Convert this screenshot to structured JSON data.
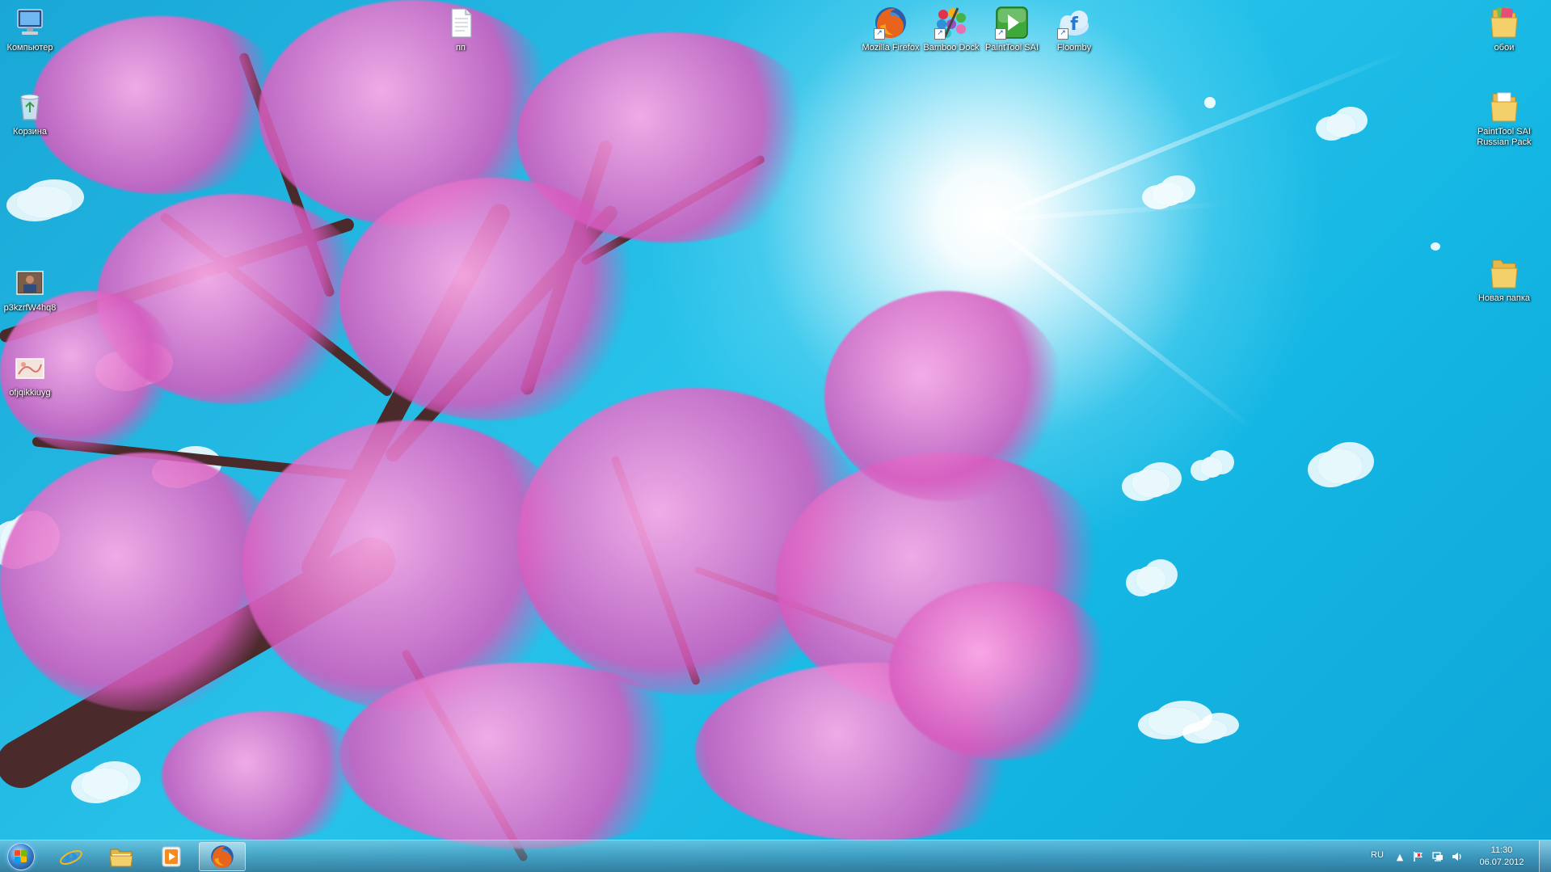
{
  "desktop": {
    "icons": [
      {
        "label": "Компьютер",
        "icon": "computer-icon"
      },
      {
        "label": "Корзина",
        "icon": "recycle-bin-icon"
      },
      {
        "label": "p3kzrfW4hq8",
        "icon": "image-file-icon"
      },
      {
        "label": "ofjqikkiuyg",
        "icon": "image-file-icon"
      },
      {
        "label": "пп",
        "icon": "text-file-icon"
      },
      {
        "label": "Mozilla Firefox",
        "icon": "firefox-icon"
      },
      {
        "label": "Bamboo Dock",
        "icon": "bamboo-dock-icon"
      },
      {
        "label": "PaintTool SAI",
        "icon": "painttool-sai-icon"
      },
      {
        "label": "Floomby",
        "icon": "floomby-icon"
      },
      {
        "label": "обои",
        "icon": "folder-icon"
      },
      {
        "label": "PaintTool SAI Russian Pack",
        "icon": "folder-icon"
      },
      {
        "label": "Новая папка",
        "icon": "folder-icon"
      }
    ]
  },
  "taskbar": {
    "pinned": [
      {
        "name": "internet-explorer",
        "icon": "internet-explorer-icon"
      },
      {
        "name": "explorer",
        "icon": "folder-icon"
      },
      {
        "name": "media-player",
        "icon": "media-player-icon"
      },
      {
        "name": "firefox",
        "icon": "firefox-icon",
        "active": true
      }
    ],
    "tray": {
      "language": "RU",
      "time": "11:30",
      "date": "06.07.2012"
    }
  },
  "colors": {
    "sky": "#1fb4e2",
    "blossom": "#d65abe",
    "branch": "#4a2a2a"
  }
}
